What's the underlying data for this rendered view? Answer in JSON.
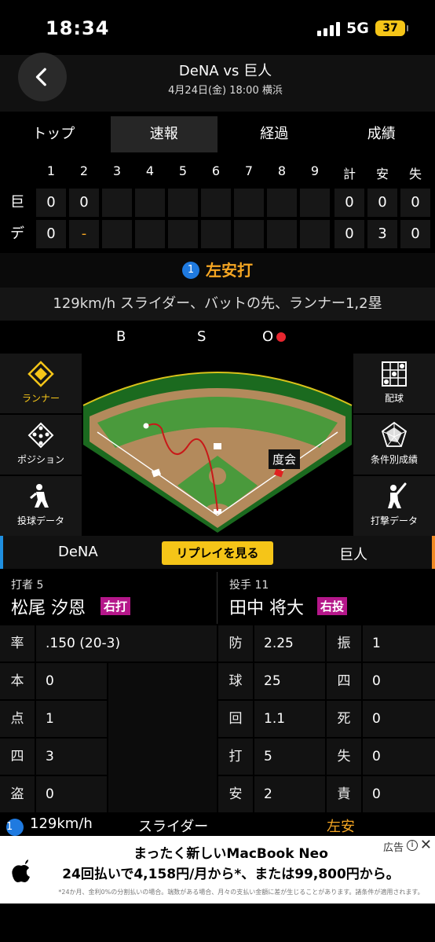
{
  "status": {
    "time": "18:34",
    "network": "5G",
    "battery": "37"
  },
  "header": {
    "title": "DeNA vs 巨人",
    "subtitle": "4月24日(金) 18:00 横浜"
  },
  "tabs": [
    "トップ",
    "速報",
    "経過",
    "成績"
  ],
  "scoreboard": {
    "innings": [
      "1",
      "2",
      "3",
      "4",
      "5",
      "6",
      "7",
      "8",
      "9"
    ],
    "totals_labels": [
      "計",
      "安",
      "失"
    ],
    "rows": [
      {
        "team": "巨",
        "scores": [
          "0",
          "0",
          "",
          "",
          "",
          "",
          "",
          "",
          ""
        ],
        "totals": [
          "0",
          "0",
          "0"
        ]
      },
      {
        "team": "デ",
        "scores": [
          "0",
          "-",
          "",
          "",
          "",
          "",
          "",
          "",
          ""
        ],
        "totals": [
          "0",
          "3",
          "0"
        ]
      }
    ]
  },
  "play": {
    "number": "1",
    "result": "左安打"
  },
  "pitch_description": "129km/h スライダー、バットの先、ランナー1,2塁",
  "count": {
    "b": "B",
    "s": "S",
    "o": "O"
  },
  "side_buttons": {
    "runner": "ランナー",
    "position": "ポジション",
    "pitch_data": "投球データ",
    "pitch_record": "配球",
    "conditional": "条件別成績",
    "batting_data": "打撃データ"
  },
  "field": {
    "runner_label": "度会"
  },
  "team_bar": {
    "home": "DeNA",
    "replay": "リプレイを見る",
    "away": "巨人"
  },
  "batter": {
    "role": "打者 5",
    "name": "松尾 汐恩",
    "tag": "右打"
  },
  "pitcher": {
    "role": "投手 11",
    "name": "田中 将大",
    "tag": "右投"
  },
  "batter_stats": [
    {
      "label": "率",
      "value": ".150 (20-3)"
    },
    {
      "label": "本",
      "value": "0"
    },
    {
      "label": "点",
      "value": "1"
    },
    {
      "label": "四",
      "value": "3"
    },
    {
      "label": "盗",
      "value": "0"
    }
  ],
  "pitcher_stats_left": [
    {
      "label": "防",
      "value": "2.25"
    },
    {
      "label": "球",
      "value": "25"
    },
    {
      "label": "回",
      "value": "1.1"
    },
    {
      "label": "打",
      "value": "5"
    },
    {
      "label": "安",
      "value": "2"
    }
  ],
  "pitcher_stats_right": [
    {
      "label": "振",
      "value": "1"
    },
    {
      "label": "四",
      "value": "0"
    },
    {
      "label": "死",
      "value": "0"
    },
    {
      "label": "失",
      "value": "0"
    },
    {
      "label": "責",
      "value": "0"
    }
  ],
  "pitch_log": {
    "number": "1",
    "speed": "129km/h",
    "type": "スライダー",
    "result": "左安"
  },
  "ad": {
    "line1": "まったく新しいMacBook Neo",
    "line2": "24回払いで4,158円/月から*、または99,800円から。",
    "note": "*24か月、金利0%の分割払いの場合。端数がある場合、月々の支払い金額に差が生じることがあります。諸条件が適用されます。",
    "label": "広告"
  },
  "colors": {
    "accent_yellow": "#f5c518",
    "hit_orange": "#f5a623",
    "tag_magenta": "#b5178a",
    "out_red": "#e8262f",
    "home_blue": "#1f8fe0",
    "away_orange": "#f08a24"
  }
}
